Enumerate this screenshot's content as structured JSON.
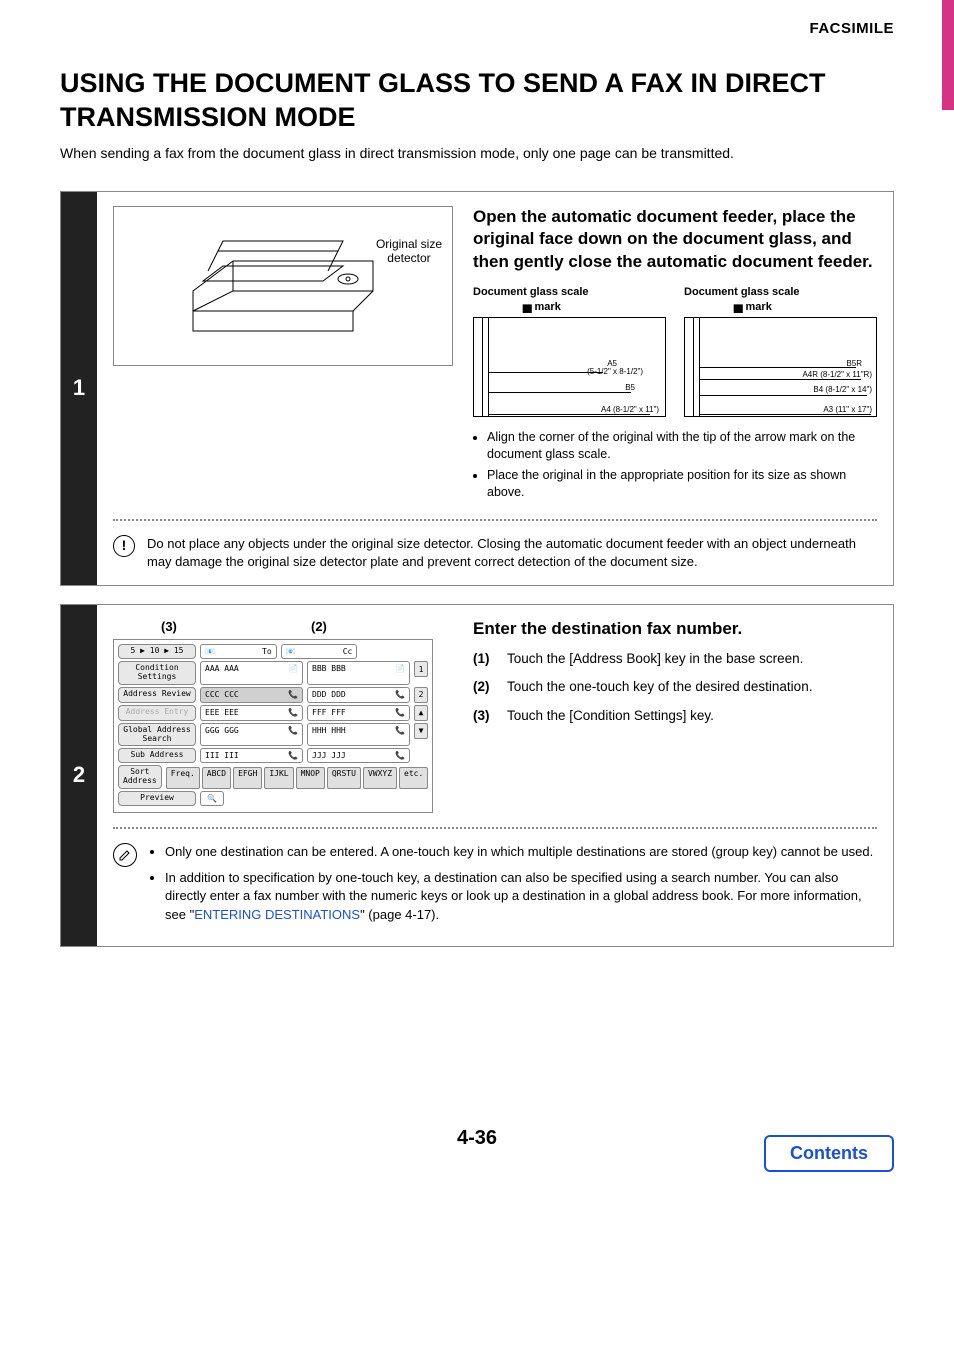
{
  "header": {
    "section": "FACSIMILE"
  },
  "title": "USING THE DOCUMENT GLASS TO SEND A FAX IN DIRECT TRANSMISSION MODE",
  "intro": "When sending a fax from the document glass in direct transmission mode, only one page can be transmitted.",
  "step1": {
    "num": "1",
    "illus_label1": "Original size",
    "illus_label2": "detector",
    "title": "Open the automatic document feeder, place the original face down on the document glass, and then gently close the automatic document feeder.",
    "scale_head": "Document glass scale",
    "mark": "mark",
    "left_sizes": {
      "a5": "A5",
      "a5d": "(5-1/2\" x 8-1/2\")",
      "b5": "B5",
      "a4": "A4 (8-1/2\" x 11\")"
    },
    "right_sizes": {
      "b5r": "B5R",
      "a4r": "A4R (8-1/2\" x 11\"R)",
      "b4": "B4 (8-1/2\" x 14\")",
      "a3": "A3 (11\" x 17\")"
    },
    "bullets": [
      "Align the corner of the original with the tip of the arrow mark  on the document glass scale.",
      "Place the original in the appropriate position for its size as shown above."
    ],
    "caution": "Do not place any objects under the original size detector. Closing the automatic document feeder with an object underneath may damage the original size detector plate and prevent correct detection of the document size."
  },
  "step2": {
    "num": "2",
    "callout3": "(3)",
    "callout2": "(2)",
    "title": "Enter the destination fax number.",
    "items": [
      {
        "n": "(1)",
        "t": "Touch the [Address Book] key in the base screen."
      },
      {
        "n": "(2)",
        "t": "Touch the one-touch key of the desired destination."
      },
      {
        "n": "(3)",
        "t": "Touch the [Condition Settings] key."
      }
    ],
    "sidebar": {
      "top": "5 ▶ 10 ▶ 15",
      "cond": "Condition Settings",
      "review": "Address Review",
      "entry": "Address Entry",
      "global": "Global Address Search",
      "sub": "Sub Address",
      "sort": "Sort Address",
      "preview": "Preview"
    },
    "ui": {
      "to": "To",
      "cc": "Cc",
      "rows": [
        [
          "AAA AAA",
          "BBB BBB"
        ],
        [
          "CCC CCC",
          "DDD DDD"
        ],
        [
          "EEE EEE",
          "FFF FFF"
        ],
        [
          "GGG GGG",
          "HHH HHH"
        ],
        [
          "III III",
          "JJJ JJJ"
        ]
      ],
      "tabs": [
        "Freq.",
        "ABCD",
        "EFGH",
        "IJKL",
        "MNOP",
        "QRSTU",
        "VWXYZ",
        "etc."
      ],
      "page1": "1",
      "page2": "2"
    },
    "notes": [
      "Only one destination can be entered. A one-touch key in which multiple destinations are stored (group key) cannot be used.",
      "In addition to specification by one-touch key, a destination can also be specified using a search number. You can also directly enter a fax number with the numeric keys or look up a destination in a global address book. For more information, see \"",
      "ENTERING DESTINATIONS",
      "\" (page 4-17)."
    ]
  },
  "footer": {
    "page": "4-36",
    "contents": "Contents"
  }
}
